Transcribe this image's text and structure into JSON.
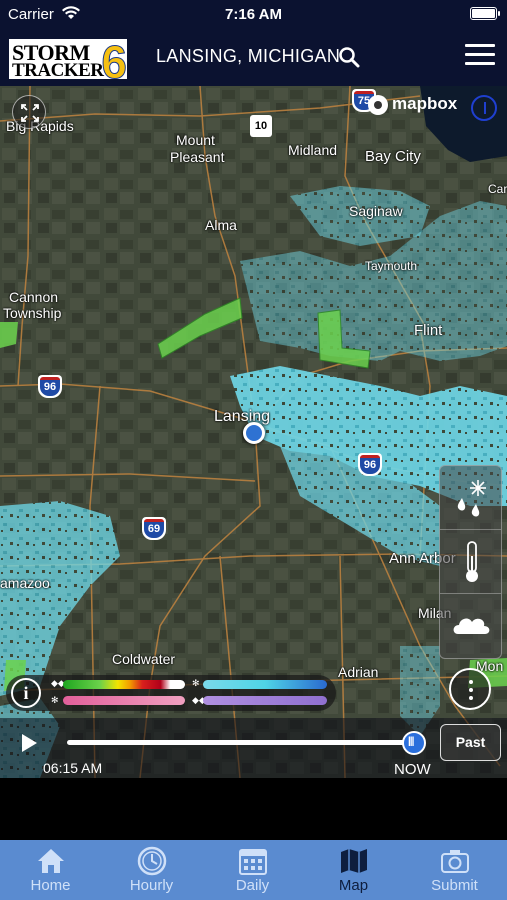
{
  "status_bar": {
    "carrier": "Carrier",
    "time": "7:16 AM"
  },
  "header": {
    "logo_line1": "STORM",
    "logo_line2": "TRACKER",
    "logo_number": "6",
    "location": "LANSING, MICHIGAN"
  },
  "map": {
    "attribution": "mapbox",
    "cities": [
      {
        "name": "Big Rapids"
      },
      {
        "name": "Mount"
      },
      {
        "name": "Pleasant"
      },
      {
        "name": "Midland"
      },
      {
        "name": "Bay City"
      },
      {
        "name": "Saginaw"
      },
      {
        "name": "Alma"
      },
      {
        "name": "Taymouth"
      },
      {
        "name": "Cannon"
      },
      {
        "name": "Township"
      },
      {
        "name": "Flint"
      },
      {
        "name": "Lansing"
      },
      {
        "name": "Ann Arbor"
      },
      {
        "name": "amazoo"
      },
      {
        "name": "Coldwater"
      },
      {
        "name": "Adrian"
      },
      {
        "name": "Milan"
      },
      {
        "name": "Mon"
      },
      {
        "name": "Car"
      }
    ],
    "shields": {
      "us10": "10",
      "i75": "75",
      "i96_west": "96",
      "i96_east": "96",
      "i69": "69"
    }
  },
  "layers": [
    "precipitation-type",
    "temperature",
    "clouds"
  ],
  "legend": {
    "info_label": "i",
    "colors": {
      "rain": [
        "#1fa51f",
        "#6ad14a",
        "#f2e400",
        "#f29a00",
        "#d8201c",
        "#b0001a",
        "#ffffff"
      ],
      "snow": [
        "#4fd4e6",
        "#7ad9e9",
        "#2a6ad0"
      ],
      "mix": [
        "#e2609a",
        "#f0a0c0"
      ],
      "ice": [
        "#9070d0",
        "#b090e0"
      ]
    }
  },
  "playback": {
    "start_time": "06:15 AM",
    "end_label": "NOW",
    "past_label": "Past",
    "progress": 1.0
  },
  "tabs": [
    {
      "label": "Home",
      "icon": "home-icon",
      "active": false
    },
    {
      "label": "Hourly",
      "icon": "clock-icon",
      "active": false
    },
    {
      "label": "Daily",
      "icon": "calendar-icon",
      "active": false
    },
    {
      "label": "Map",
      "icon": "map-icon",
      "active": true
    },
    {
      "label": "Submit",
      "icon": "camera-icon",
      "active": false
    }
  ]
}
